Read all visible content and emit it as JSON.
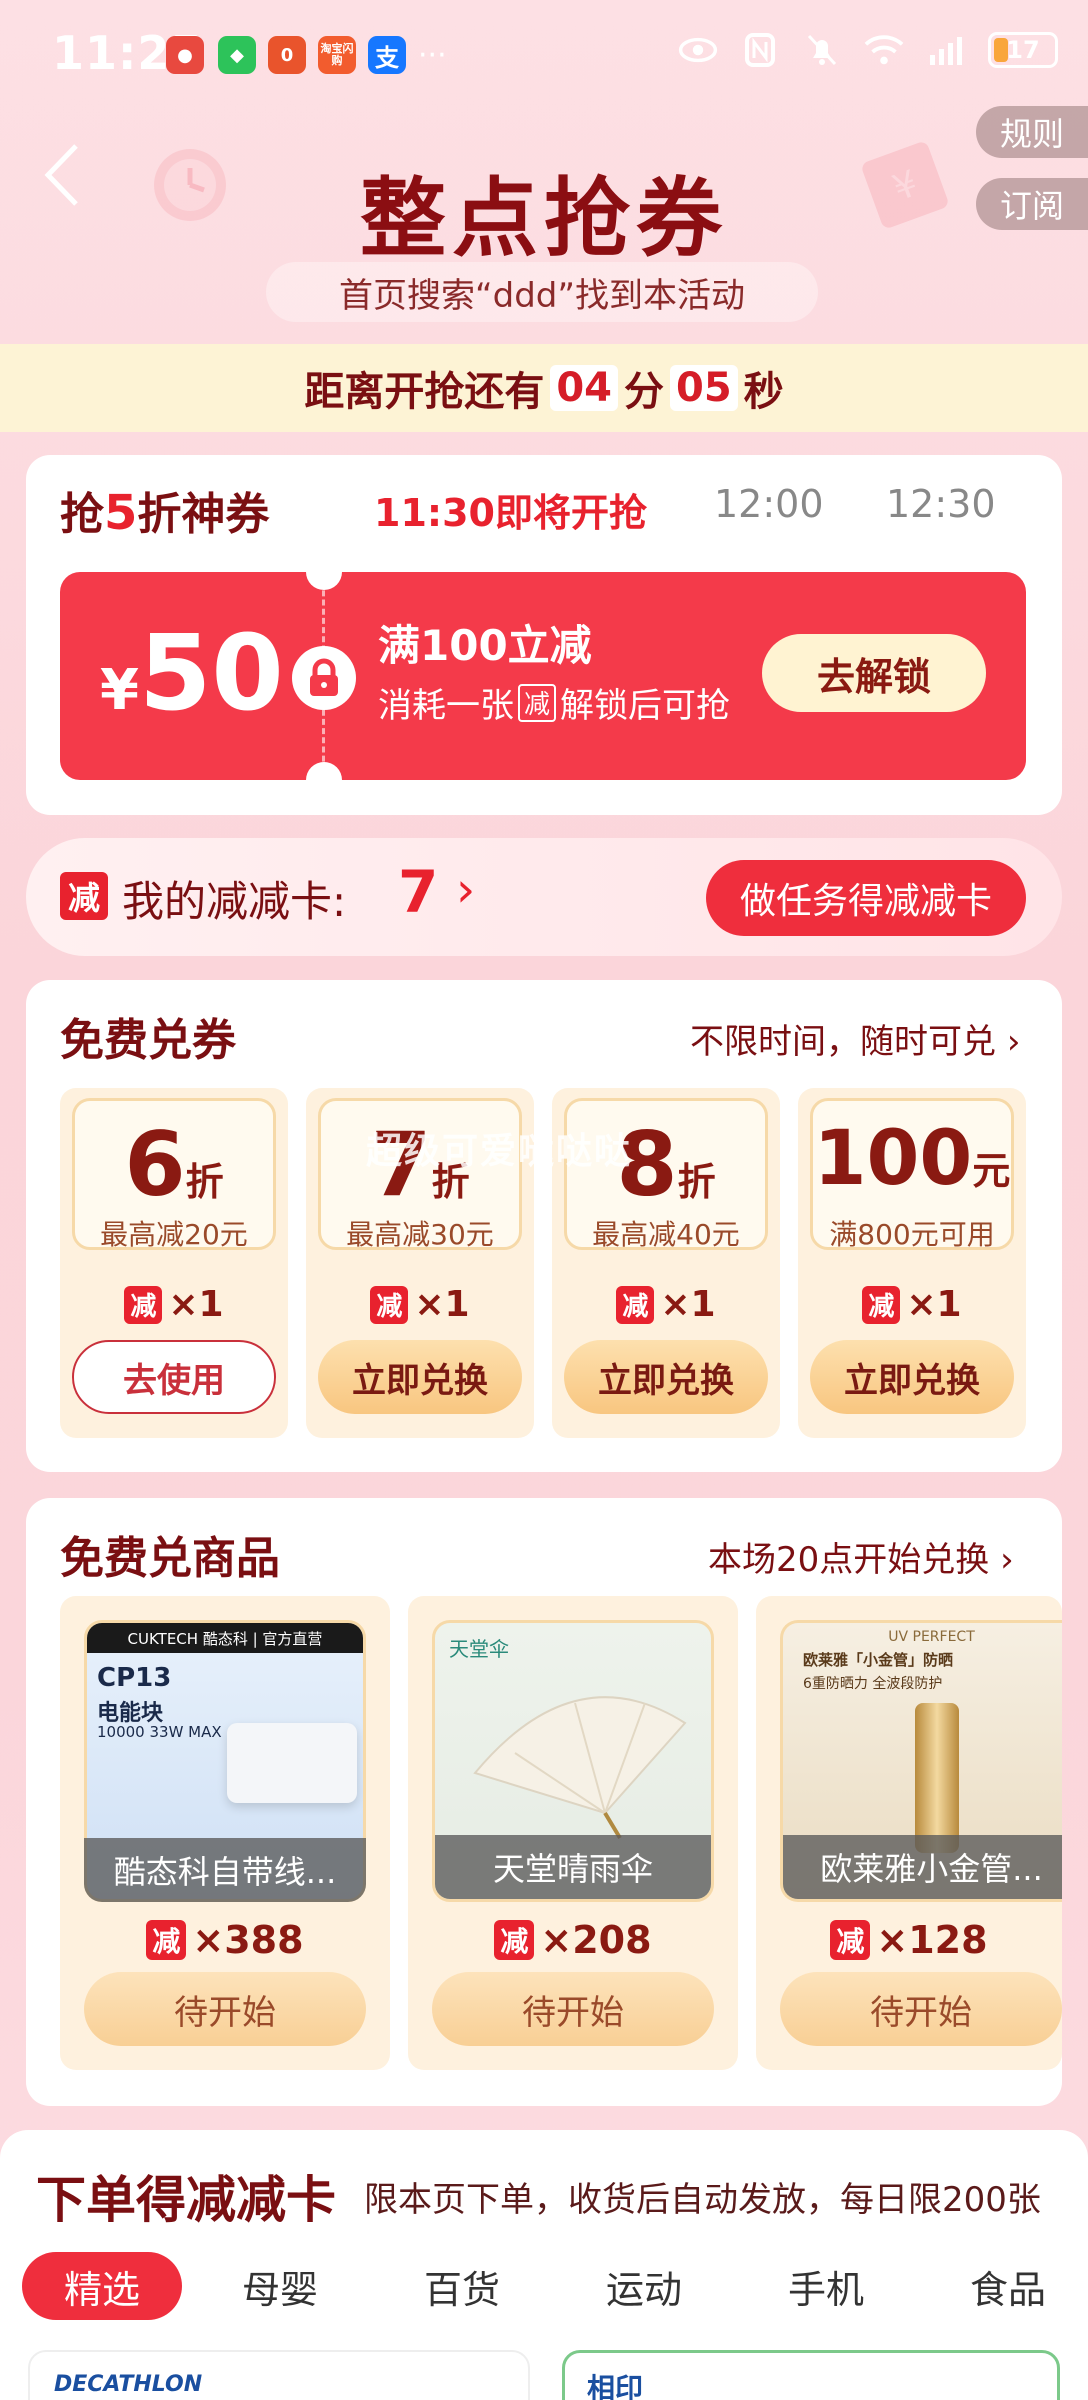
{
  "status_bar": {
    "time": "11:25",
    "battery": "17",
    "apps": [
      {
        "icon": "app-icon-red",
        "label": "",
        "color": "#e8493f"
      },
      {
        "icon": "wechat-icon",
        "label": "",
        "color": "#2dc35a"
      },
      {
        "icon": "app-icon-orange",
        "label": "0",
        "color": "#e9542c"
      },
      {
        "icon": "taobao-flash-icon",
        "label": "淘宝闪购",
        "color": "#f25c2e"
      },
      {
        "icon": "alipay-icon",
        "label": "支",
        "color": "#1677ff"
      }
    ]
  },
  "header": {
    "title": "整点抢券",
    "rules": "规则",
    "subscribe": "订阅",
    "search_hint": "首页搜索“ddd”找到本活动"
  },
  "countdown": {
    "prefix": "距离开抢还有",
    "minutes": "04",
    "min_unit": "分",
    "seconds": "05",
    "sec_unit": "秒"
  },
  "flash_coupon": {
    "title_a": "抢",
    "title_b": "5",
    "title_c": "折神券",
    "tabs": [
      "11:30即将开抢",
      "12:00",
      "12:30"
    ],
    "yen": "¥",
    "amount": "50",
    "main": "满100立减",
    "sub_a": "消耗一张",
    "sub_jian": "减",
    "sub_b": "解锁后可抢",
    "button": "去解锁"
  },
  "my_card": {
    "badge": "减",
    "label": "我的减减卡:",
    "count": "7",
    "arrow": "›",
    "task_button": "做任务得减减卡"
  },
  "free_coupons": {
    "title": "免费兑券",
    "right": "不限时间，随时可兑",
    "watermark": "超级可爱哒哒哒",
    "items": [
      {
        "big": "6",
        "unit": "折",
        "desc": "最高减20元",
        "badge": "减",
        "count": "×1",
        "button": "去使用"
      },
      {
        "big": "7",
        "unit": "折",
        "desc": "最高减30元",
        "badge": "减",
        "count": "×1",
        "button": "立即兑换"
      },
      {
        "big": "8",
        "unit": "折",
        "desc": "最高减40元",
        "badge": "减",
        "count": "×1",
        "button": "立即兑换"
      },
      {
        "big": "100",
        "unit": "元",
        "desc": "满800元可用",
        "badge": "减",
        "count": "×1",
        "button": "立即兑换"
      }
    ]
  },
  "free_goods": {
    "title": "免费兑商品",
    "right": "本场20点开始兑换",
    "items": [
      {
        "name": "酷态科自带线...",
        "badge": "减",
        "count": "×388",
        "button": "待开始",
        "brand": "CUKTECH 酷态科 | 官方直营",
        "model": "CP13",
        "line2": "电能块",
        "line3": "10000 33W MAX"
      },
      {
        "name": "天堂晴雨伞",
        "badge": "减",
        "count": "×208",
        "button": "待开始",
        "brand": "天堂伞"
      },
      {
        "name": "欧莱雅小金管...",
        "badge": "减",
        "count": "×128",
        "button": "待开始",
        "brand": "UV PERFECT",
        "line2": "欧莱雅「小金管」防晒",
        "line3": "6重防晒力 全波段防护"
      }
    ]
  },
  "order_section": {
    "title": "下单得减减卡",
    "desc": "限本页下单，收货后自动发放，每日限200张",
    "tabs": [
      "精选",
      "母婴",
      "百货",
      "运动",
      "手机",
      "食品"
    ],
    "thumb_left": "DECATHLON",
    "thumb_right": "相印"
  }
}
